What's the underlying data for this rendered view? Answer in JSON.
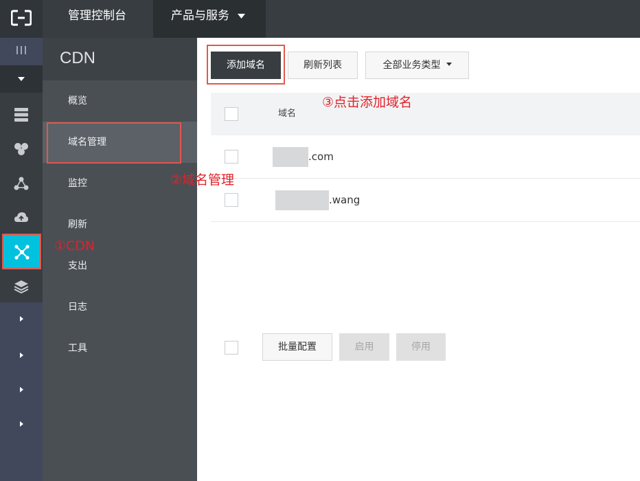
{
  "topbar": {
    "logo_icon": "aliyun-logo-icon",
    "console_label": "管理控制台",
    "products_label": "产品与服务"
  },
  "rail": {
    "icons": [
      "menu-bars-icon",
      "caret-down-icon",
      "server-icon",
      "cluster-icon",
      "network-icon",
      "cloud-icon",
      "cdn-icon",
      "layers-icon",
      "chevron-right-icon"
    ]
  },
  "subnav": {
    "title": "CDN",
    "items": [
      {
        "label": "概览"
      },
      {
        "label": "域名管理"
      },
      {
        "label": "监控"
      },
      {
        "label": "刷新"
      },
      {
        "label": "支出"
      },
      {
        "label": "日志"
      },
      {
        "label": "工具"
      }
    ]
  },
  "toolbar": {
    "add_domain_label": "添加域名",
    "refresh_label": "刷新列表",
    "business_type_label": "全部业务类型"
  },
  "table": {
    "header_domain": "域名",
    "rows": [
      {
        "domain_suffix": ".com"
      },
      {
        "domain_suffix": ".wang"
      }
    ]
  },
  "footer_actions": {
    "batch_label": "批量配置",
    "enable_label": "启用",
    "disable_label": "停用"
  },
  "annotations": {
    "step1": "①CDN",
    "step2": "②域名管理",
    "step3": "③点击添加域名"
  },
  "colors": {
    "accent_active": "#00c1de",
    "annotation_red": "#e2222a",
    "topbar": "#373d41"
  }
}
